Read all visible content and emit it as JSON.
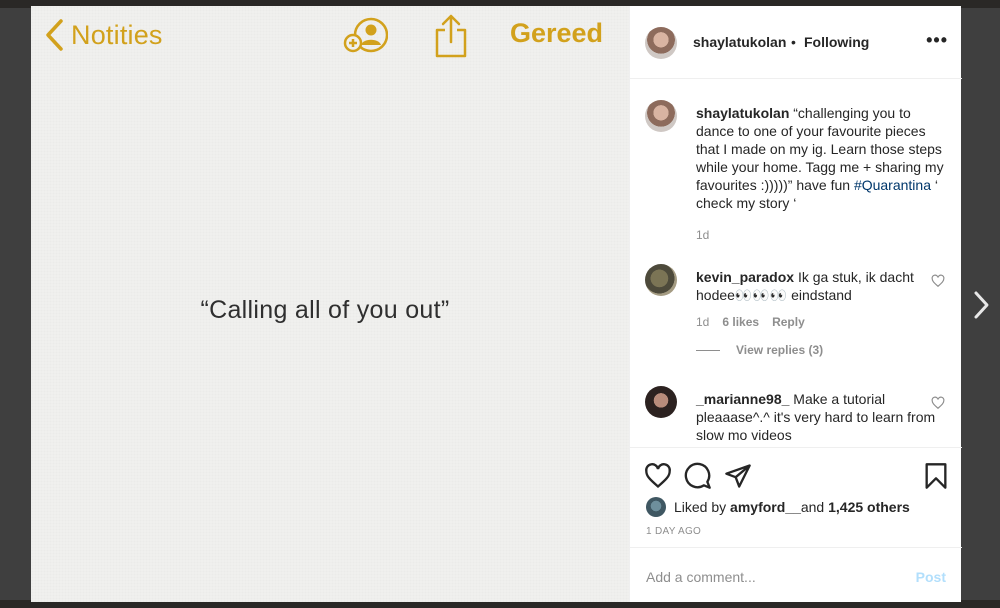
{
  "media": {
    "back_label": "Notities",
    "done_label": "Gereed",
    "quote": "“Calling all of you out”"
  },
  "post": {
    "username": "shaylatukolan",
    "separator": "•",
    "follow_state": "Following",
    "more_label": "•••"
  },
  "caption": {
    "username": "shaylatukolan",
    "text_before": " “challenging you to dance to one of your favourite pieces that I made on my ig. Learn those steps while your home. Tagg me + sharing my favourites :)))))” have fun ",
    "hashtag": "#Quarantina",
    "text_after": " ‘ check my story ‘",
    "time": "1d"
  },
  "comments": [
    {
      "username": "kevin_paradox",
      "text": " Ik ga stuk, ik dacht hodee👀👀👀 eindstand",
      "time": "1d",
      "likes": "6 likes",
      "reply": "Reply",
      "view_replies": "View replies (3)"
    },
    {
      "username": "_marianne98_",
      "text": " Make a tutorial pleaaase^.^ it's very hard to learn from slow mo videos"
    }
  ],
  "likes": {
    "prefix": "Liked by ",
    "user": "amyford__",
    "middle": " and ",
    "count": "1,425 others"
  },
  "timestamp": "1 DAY AGO",
  "comment_box": {
    "placeholder": "Add a comment...",
    "post_label": "Post"
  },
  "colors": {
    "notes_accent": "#d2a11c",
    "link": "#00376b",
    "muted": "#8e8e8e",
    "post_disabled": "#b2dffc"
  }
}
